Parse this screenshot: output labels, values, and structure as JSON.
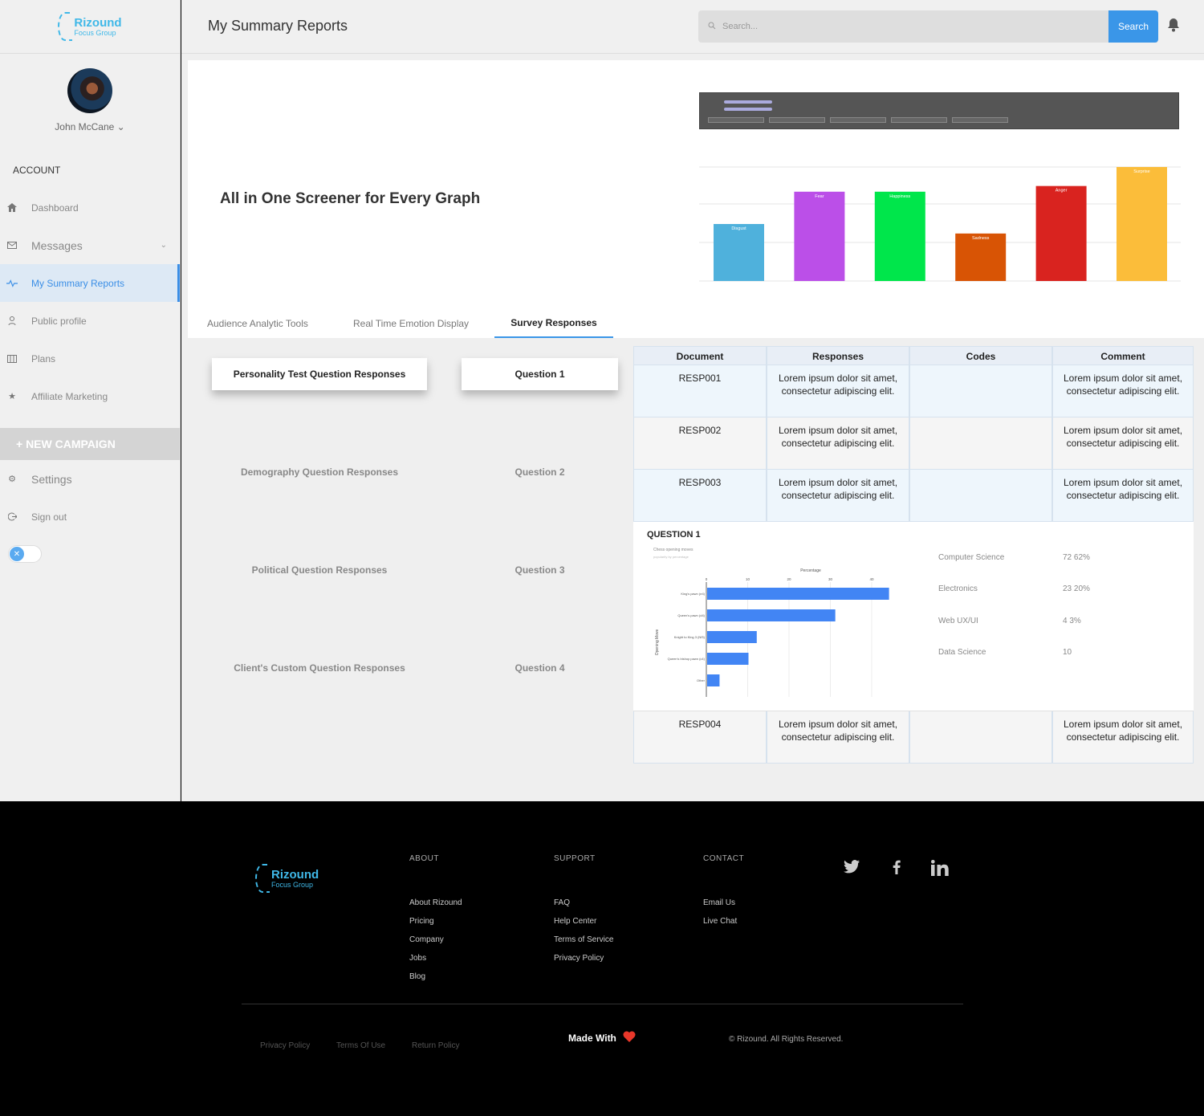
{
  "brand": {
    "name": "Rizound",
    "tagline": "Focus Group"
  },
  "user": {
    "name": "John McCane"
  },
  "sidebar": {
    "section": "ACCOUNT",
    "items": [
      {
        "label": "Dashboard",
        "icon": "home-icon"
      },
      {
        "label": "Messages",
        "icon": "messages-icon"
      },
      {
        "label": "My Summary Reports",
        "icon": "pulse-icon"
      },
      {
        "label": "Public profile",
        "icon": "user-icon"
      },
      {
        "label": "Plans",
        "icon": "plans-icon"
      },
      {
        "label": "Affiliate Marketing",
        "icon": "star-icon"
      }
    ],
    "campaign": "+ NEW CAMPAIGN",
    "settings": "Settings",
    "signout": "Sign out"
  },
  "header": {
    "title": "My Summary Reports",
    "search_placeholder": "Search...",
    "search_button": "Search"
  },
  "main": {
    "hero": "All in One Screener for Every Graph",
    "tabs": [
      "Audience Analytic Tools",
      "Real Time Emotion Display",
      "Survey Responses"
    ],
    "questions": [
      {
        "label": "Personality Test Question Responses",
        "q": "Question 1"
      },
      {
        "label": "Demography Question Responses",
        "q": "Question 2"
      },
      {
        "label": "Political Question Responses",
        "q": "Question 3"
      },
      {
        "label": "Client's Custom Question Responses",
        "q": "Question 4"
      }
    ]
  },
  "chart_data": [
    {
      "type": "bar",
      "categories": [
        "Disgust",
        "Fear",
        "Happiness",
        "Sadness",
        "Anger",
        "Surprise"
      ],
      "values": [
        30,
        47,
        47,
        25,
        50,
        60
      ],
      "colors": [
        "#4fb1dc",
        "#bb4fe8",
        "#00e64b",
        "#d85405",
        "#d9231f",
        "#fbbd3a"
      ],
      "grid": true
    },
    {
      "type": "bar",
      "orientation": "horizontal",
      "title": "Chess opening moves",
      "subtitle": "popularity by percentage",
      "xlabel": "Percentage",
      "ylabel": "Opening Move",
      "categories": [
        "King's pawn (e4)",
        "Queen's pawn (d4)",
        "Knight to King 3 (Nf3)",
        "Queen's bishop pawn (c4)",
        "Other"
      ],
      "values": [
        44,
        31,
        12,
        10,
        3
      ],
      "xticks": [
        0,
        10,
        20,
        30,
        40
      ],
      "xlim": [
        0,
        50
      ],
      "color": "#4285f4"
    }
  ],
  "table": {
    "headers": [
      "Document",
      "Responses",
      "Codes",
      "Comment"
    ],
    "rows": [
      {
        "doc": "RESP001",
        "resp": "Lorem ipsum dolor sit amet, consectetur adipiscing elit.",
        "codes": "",
        "comment": "Lorem ipsum dolor sit amet, consectetur adipiscing elit."
      },
      {
        "doc": "RESP002",
        "resp": "Lorem ipsum dolor sit amet, consectetur adipiscing elit.",
        "codes": "",
        "comment": "Lorem ipsum dolor sit amet, consectetur adipiscing elit."
      },
      {
        "doc": "RESP003",
        "resp": "Lorem ipsum dolor sit amet, consectetur adipiscing elit.",
        "codes": "",
        "comment": "Lorem ipsum dolor sit amet, consectetur adipiscing elit."
      },
      {
        "doc": "RESP004",
        "resp": "Lorem ipsum dolor sit amet, consectetur adipiscing elit.",
        "codes": "",
        "comment": "Lorem ipsum dolor sit amet, consectetur adipiscing elit."
      }
    ]
  },
  "question_panel": {
    "title": "QUESTION 1",
    "stats": [
      {
        "label": "Computer Science",
        "value": "72   62%"
      },
      {
        "label": "Electronics",
        "value": "23   20%"
      },
      {
        "label": "Web UX/UI",
        "value": "4   3%"
      },
      {
        "label": "Data Science",
        "value": "10"
      }
    ]
  },
  "footer": {
    "about": {
      "title": "ABOUT",
      "links": [
        "About  Rizound",
        "Pricing",
        "Company",
        "Jobs",
        "Blog"
      ]
    },
    "support": {
      "title": "SUPPORT",
      "links": [
        "FAQ",
        "Help Center",
        "Terms of Service",
        "Privacy Policy"
      ]
    },
    "contact": {
      "title": "CONTACT",
      "links": [
        "Email Us",
        "Live Chat"
      ]
    },
    "social": [
      "twitter-icon",
      "facebook-icon",
      "linkedin-icon"
    ],
    "bottom_links": [
      "Privacy Policy",
      "Terms Of Use",
      "Return Policy"
    ],
    "made_with": "Made With",
    "copyright": "© Rizound. All Rights Reserved."
  }
}
